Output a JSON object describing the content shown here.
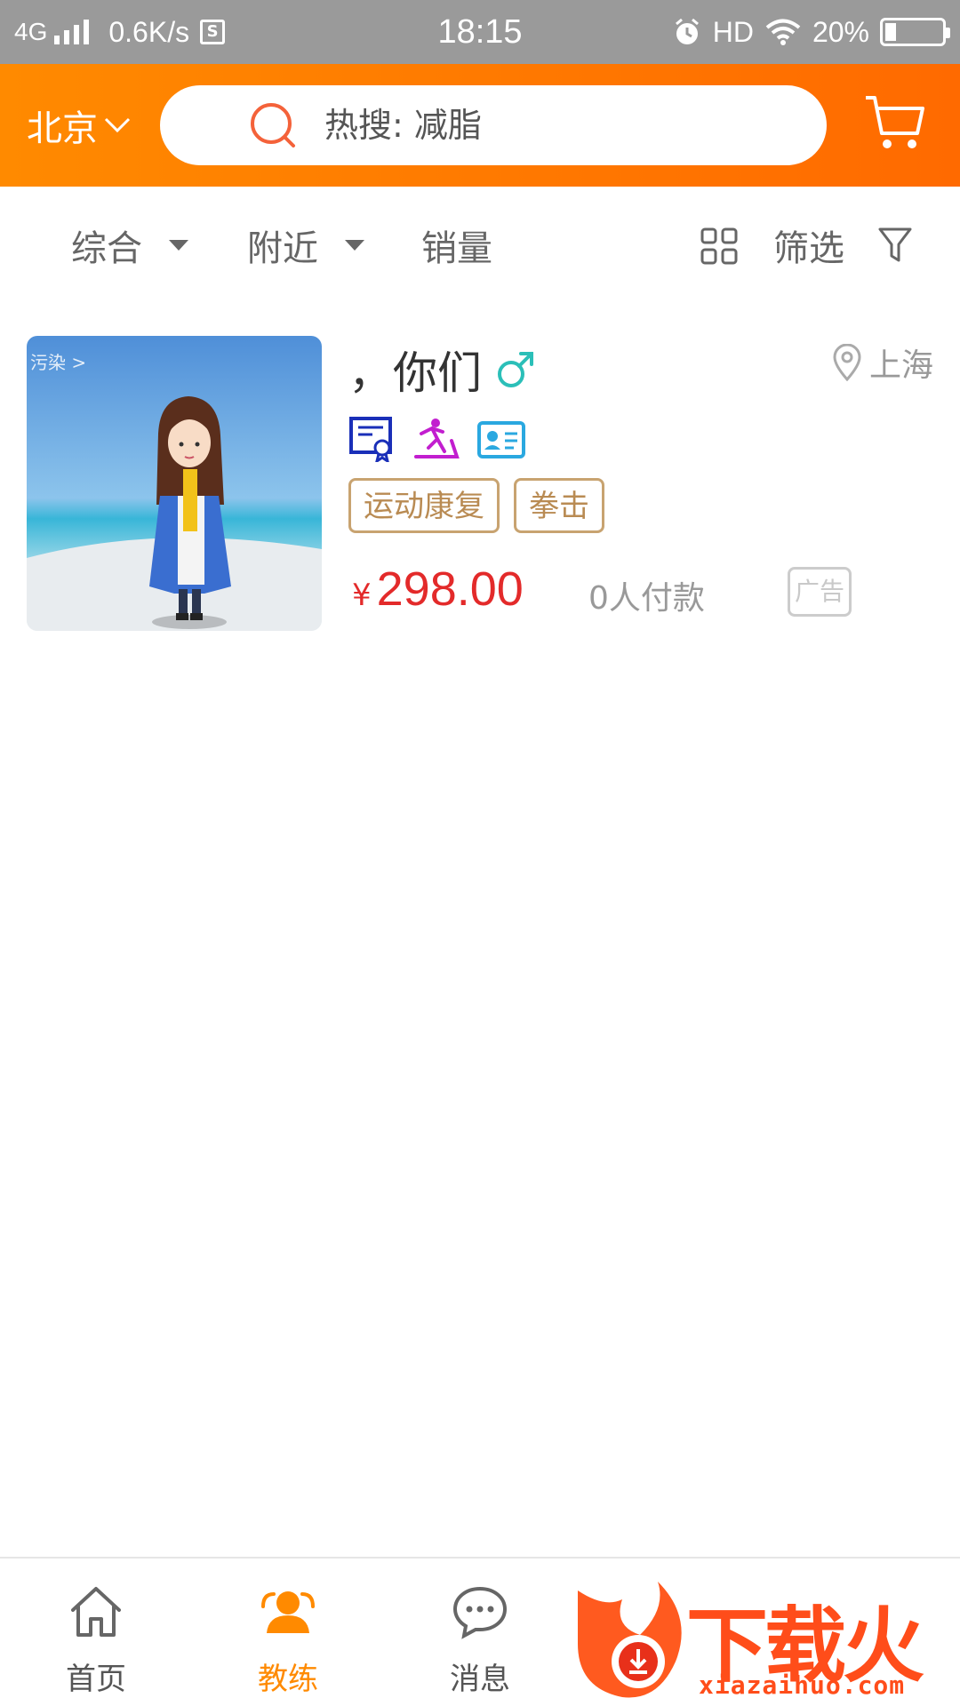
{
  "status_bar": {
    "network": "4G",
    "speed": "0.6K/s",
    "s_badge": "S",
    "time": "18:15",
    "hd": "HD",
    "battery": "20%",
    "battery_level": 0.2
  },
  "header": {
    "city": "北京",
    "search_placeholder": "热搜: 减脂"
  },
  "filter_bar": {
    "sort_general": "综合",
    "nearby": "附近",
    "sales": "销量",
    "filter": "筛选"
  },
  "listings": [
    {
      "thumb_tag": "污染 >",
      "name": "，你们",
      "gender": "male",
      "location": "上海",
      "badges": [
        "certificate-icon",
        "fitness-icon",
        "id-card-icon"
      ],
      "tags": [
        "运动康复",
        "拳击"
      ],
      "currency": "¥",
      "price": "298.00",
      "sales": "0人付款",
      "ad_label": "广告"
    }
  ],
  "tabbar": {
    "tabs": [
      {
        "label": "首页",
        "icon": "home-icon"
      },
      {
        "label": "教练",
        "icon": "coach-icon",
        "active": true
      },
      {
        "label": "消息",
        "icon": "message-icon"
      }
    ]
  },
  "watermark": {
    "brand": "下载火",
    "url": "xiazaihuo.com"
  },
  "colors": {
    "accent": "#ff8a00",
    "price": "#e32a2a",
    "tag_border": "#c8a370"
  }
}
